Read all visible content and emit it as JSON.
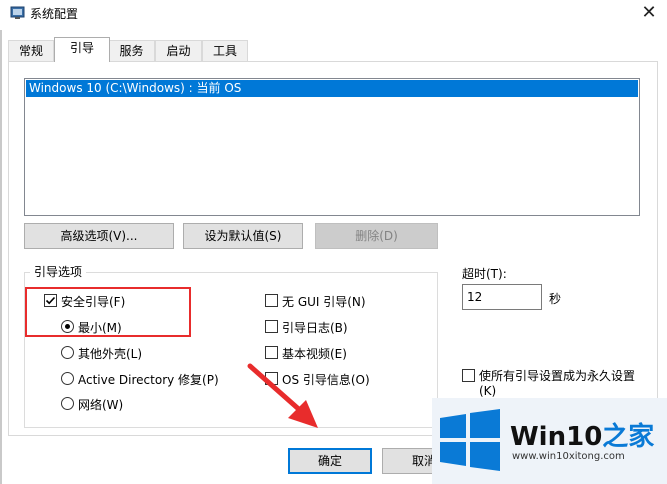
{
  "window": {
    "title": "系统配置",
    "close_glyph": "✕"
  },
  "tabs": [
    "常规",
    "引导",
    "服务",
    "启动",
    "工具"
  ],
  "os_list": {
    "selected": "Windows 10 (C:\\Windows) : 当前 OS"
  },
  "os_buttons": {
    "advanced": "高级选项(V)...",
    "set_default": "设为默认值(S)",
    "delete": "删除(D)"
  },
  "boot_options": {
    "group_label": "引导选项",
    "safe_boot": {
      "label": "安全引导(F)",
      "checked": true
    },
    "radios": [
      {
        "label": "最小(M)",
        "selected": true
      },
      {
        "label": "其他外壳(L)",
        "selected": false
      },
      {
        "label": "Active Directory 修复(P)",
        "selected": false
      },
      {
        "label": "网络(W)",
        "selected": false
      }
    ],
    "right_checks": [
      {
        "label": "无 GUI 引导(N)",
        "checked": false
      },
      {
        "label": "引导日志(B)",
        "checked": false
      },
      {
        "label": "基本视频(E)",
        "checked": false
      },
      {
        "label": "OS 引导信息(O)",
        "checked": false
      }
    ]
  },
  "timeout": {
    "label": "超时(T):",
    "value": "12",
    "unit": "秒"
  },
  "permanent": {
    "line1": "使所有引导设置成为永久设置",
    "line2": "(K)",
    "checked": false
  },
  "dialog_buttons": {
    "ok": "确定",
    "cancel": "取消"
  },
  "watermark": {
    "brand": "Win10",
    "brand_suffix": "之家",
    "url": "www.win10xitong.com"
  },
  "annotation_colors": {
    "highlight": "#e82c2c",
    "accent": "#0078d7"
  }
}
